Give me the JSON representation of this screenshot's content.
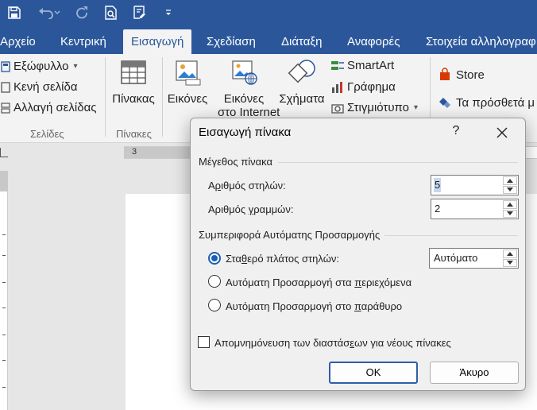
{
  "qat": {
    "save_icon": "save-icon",
    "undo_icon": "undo-icon",
    "redo_icon": "redo-icon",
    "print_preview_icon": "print-preview-icon",
    "form_icon": "form-icon",
    "customize_icon": "customize-icon"
  },
  "tabs": [
    {
      "label": "Αρχείο"
    },
    {
      "label": "Κεντρική"
    },
    {
      "label": "Εισαγωγή"
    },
    {
      "label": "Σχεδίαση"
    },
    {
      "label": "Διάταξη"
    },
    {
      "label": "Αναφορές"
    },
    {
      "label": "Στοιχεία αλληλογραφ"
    }
  ],
  "ribbon": {
    "pages": {
      "cover": "Εξώφυλλο",
      "blank": "Κενή σελίδα",
      "break": "Αλλαγή σελίδας",
      "group": "Σελίδες"
    },
    "tables": {
      "table": "Πίνακας",
      "group": "Πίνακες"
    },
    "illustrations": {
      "pictures": "Εικόνες",
      "online_1": "Εικόνες",
      "online_2": "στο Internet",
      "shapes": "Σχήματα",
      "smartart": "SmartArt",
      "chart": "Γράφημα",
      "screenshot": "Στιγμιότυπο"
    },
    "addins": {
      "store": "Store",
      "my_addins": "Τα πρόσθετά μ"
    }
  },
  "ruler": {
    "number": "3"
  },
  "dialog": {
    "title": "Εισαγωγή πίνακα",
    "help": "?",
    "table_size": "Μέγεθος πίνακα",
    "cols_label_pre": "Α",
    "cols_label_u": "ρ",
    "cols_label_post": "ιθμός στηλών:",
    "cols_value": "5",
    "rows_label_pre": "Αριθμός ",
    "rows_label_u": "γ",
    "rows_label_post": "ραμμών:",
    "rows_value": "2",
    "autofit": "Συμπεριφορά Αυτόματης Προσαρμογής",
    "fixed_pre": "Στα",
    "fixed_u": "θ",
    "fixed_post": "ερό πλάτος στηλών:",
    "fixed_value": "Αυτόματο",
    "contents_pre": "Αυτόματη Προσαρμογή στα ",
    "contents_u": "π",
    "contents_post": "εριεχόμενα",
    "window_pre": "Αυτόματη Προσαρμογή στο ",
    "window_u": "π",
    "window_post": "αράθυρο",
    "remember_pre": "Απομνημόνευση των διαστάσ",
    "remember_u": "ε",
    "remember_post": "ων για νέους πίνακες",
    "ok": "OK",
    "cancel": "Άκυρο"
  },
  "colors": {
    "accent": "#2b579a",
    "radio": "#1a5fb4"
  }
}
